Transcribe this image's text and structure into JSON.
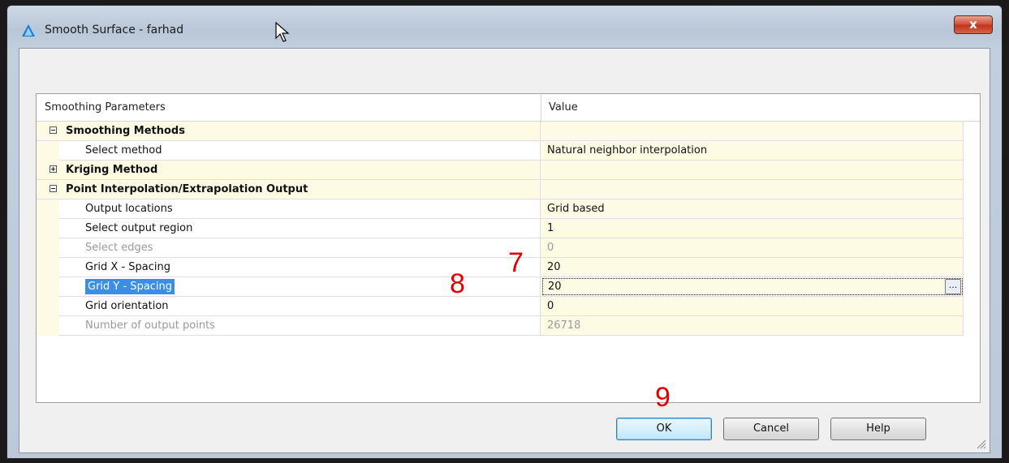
{
  "window": {
    "title": "Smooth Surface - farhad",
    "close_label": "x"
  },
  "grid": {
    "columns": [
      "Smoothing Parameters",
      "Value"
    ],
    "rows": [
      {
        "kind": "category",
        "expander": "minus",
        "label": "Smoothing Methods",
        "value": ""
      },
      {
        "kind": "prop",
        "label": "Select method",
        "value": "Natural neighbor interpolation"
      },
      {
        "kind": "category",
        "expander": "plus",
        "label": "Kriging Method",
        "value": ""
      },
      {
        "kind": "category",
        "expander": "minus",
        "label": "Point Interpolation/Extrapolation Output",
        "value": ""
      },
      {
        "kind": "prop",
        "label": "Output locations",
        "value": "Grid based"
      },
      {
        "kind": "prop",
        "label": "Select output region",
        "value": "1"
      },
      {
        "kind": "prop",
        "disabled": true,
        "label": "Select edges",
        "value": "0"
      },
      {
        "kind": "prop",
        "label": "Grid X - Spacing",
        "value": "20"
      },
      {
        "kind": "prop",
        "selected": true,
        "label": "Grid Y - Spacing",
        "value": "20"
      },
      {
        "kind": "prop",
        "label": "Grid orientation",
        "value": "0"
      },
      {
        "kind": "prop",
        "disabled": true,
        "label": "Number of output points",
        "value": "26718"
      }
    ],
    "edit_button_label": "..."
  },
  "annotations": [
    "7",
    "8",
    "9"
  ],
  "buttons": {
    "ok": "OK",
    "cancel": "Cancel",
    "help": "Help"
  },
  "colors": {
    "value_background": "#fdfbe4",
    "selection": "#3a8ee6",
    "annotation": "#e00000"
  }
}
